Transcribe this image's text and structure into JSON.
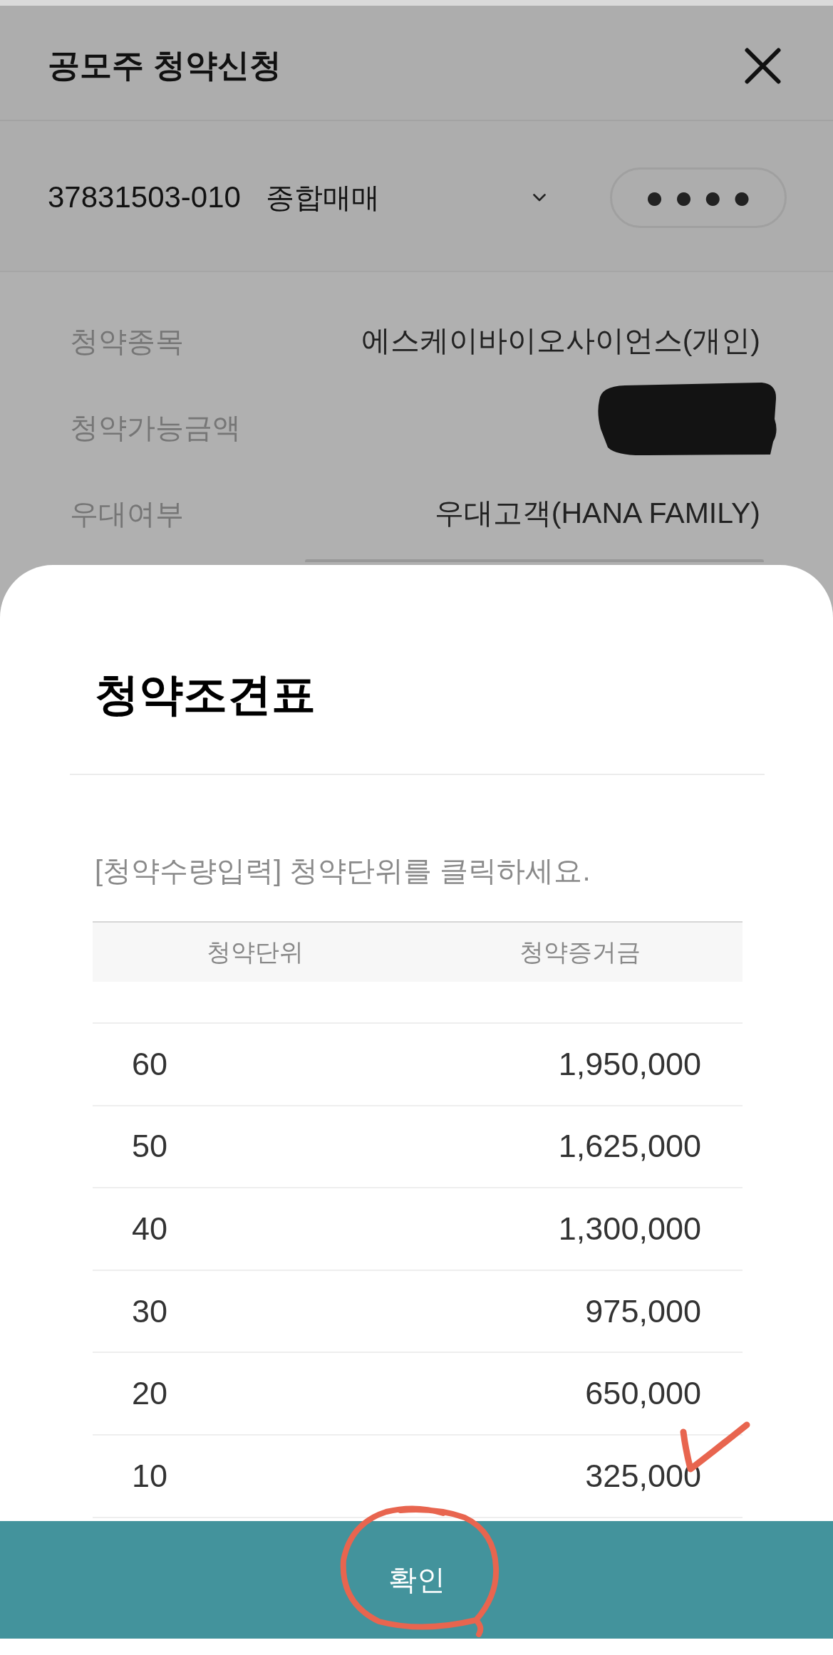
{
  "header": {
    "title": "공모주 청약신청"
  },
  "account": {
    "number": "37831503-010",
    "type": "종합매매",
    "password": {
      "value": "●●●●"
    }
  },
  "info": [
    {
      "label": "청약종목",
      "kind": "text",
      "value": "에스케이바이오사이언스(개인)"
    },
    {
      "label": "청약가능금액",
      "kind": "redacted"
    },
    {
      "label": "우대여부",
      "kind": "text",
      "value": "우대고객(HANA FAMILY)"
    }
  ],
  "sheet": {
    "title": "청약조견표",
    "instruction": "[청약수량입력] 청약단위를 클릭하세요.",
    "table": {
      "columns": [
        "청약단위",
        "청약증거금"
      ],
      "rows": [
        [
          "60",
          "1,950,000"
        ],
        [
          "50",
          "1,625,000"
        ],
        [
          "40",
          "1,300,000"
        ],
        [
          "30",
          "975,000"
        ],
        [
          "20",
          "650,000"
        ],
        [
          "10",
          "325,000"
        ]
      ]
    },
    "confirm_button": "확인"
  }
}
